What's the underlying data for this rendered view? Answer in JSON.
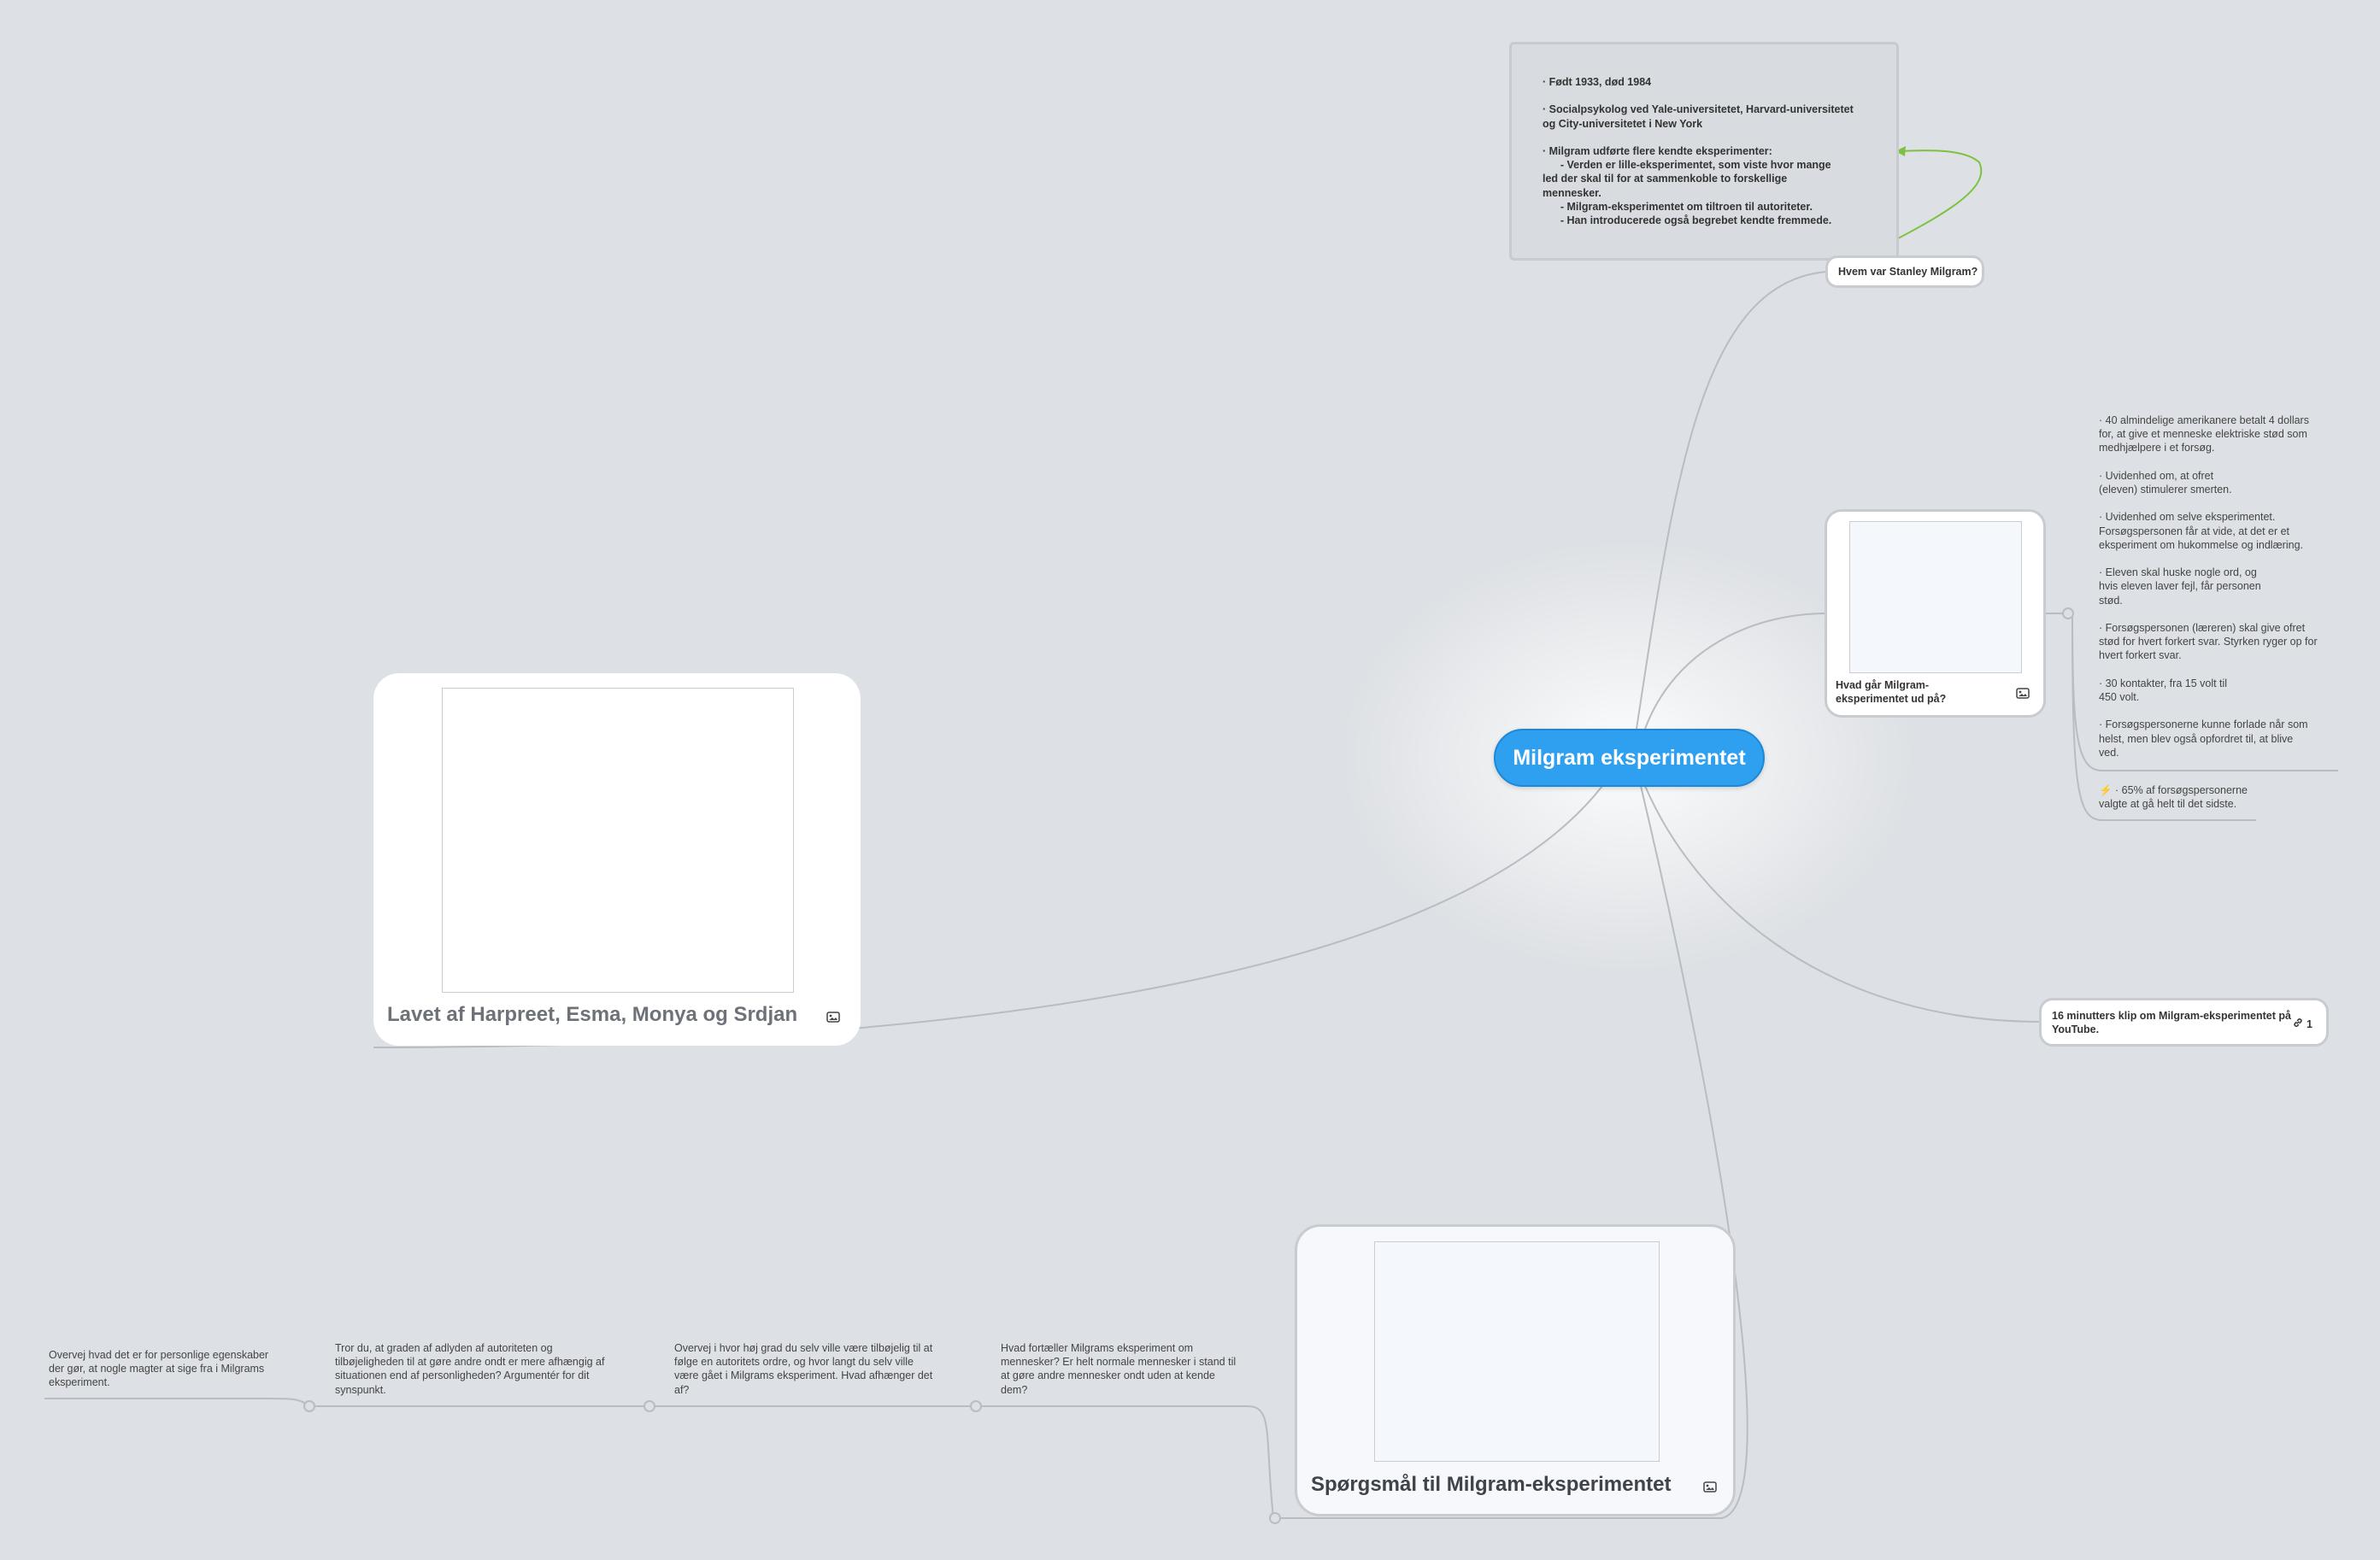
{
  "central": {
    "title": "Milgram eksperimentet"
  },
  "stanley": {
    "label": "Hvem var Stanley Milgram?",
    "note": [
      "· Født 1933, død 1984",
      "· Socialpsykolog ved Yale-universitetet, Harvard-universitetet\nog City-universitetet i New York",
      "· Milgram udførte flere kendte eksperimenter:\n      - Verden er lille-eksperimentet, som viste hvor mange\nled der skal til for at sammenkoble to forskellige\nmennesker.\n      - Milgram-eksperimentet om tiltroen til autoriteter.\n      - Han introducerede også begrebet kendte fremmede."
    ]
  },
  "hvad": {
    "label": "Hvad går Milgram-eksperimentet ud på?",
    "icon": "image-icon",
    "facts": [
      "· 40 almindelige amerikanere betalt 4 dollars\nfor, at give et menneske elektriske stød som\nmedhjælpere i et forsøg.",
      "· Uvidenhed om, at ofret\n(eleven) stimulerer smerten.",
      "· Uvidenhed om selve eksperimentet.\nForsøgspersonen får at vide, at det er et\neksperiment om hukommelse og indlæring.",
      "· Eleven skal huske nogle ord, og\nhvis eleven laver fejl, får personen\nstød.",
      "· Forsøgspersonen (læreren) skal give ofret\nstød for hvert forkert svar. Styrken ryger op for\nhvert forkert svar.",
      "· 30 kontakter, fra 15 volt til\n450 volt.",
      "· Forsøgspersonerne kunne forlade når som\nhelst, men blev også opfordret til, at blive\nved."
    ],
    "fact_last": "⚡ · 65% af forsøgspersonerne\nvalgte at gå helt til det sidste."
  },
  "klip": {
    "label": "16 minutters klip om Milgram-eksperimentet på YouTube.",
    "link_count": "1",
    "icon": "link-icon"
  },
  "lavet": {
    "label": "Lavet af Harpreet, Esma, Monya og Srdjan",
    "icon": "image-icon"
  },
  "sporgsmal": {
    "label": "Spørgsmål til Milgram-eksperimentet",
    "icon": "image-icon",
    "questions": [
      "Hvad fortæller Milgrams eksperiment om\nmennesker? Er helt normale mennesker i stand til\nat gøre andre mennesker ondt uden at kende\ndem?",
      "Overvej i hvor høj grad du selv ville være tilbøjelig til at\nfølge en autoritets ordre, og hvor langt du selv ville\nvære gået i Milgrams eksperiment. Hvad afhænger det\naf?",
      "Tror du, at graden af adlyden af autoriteten og\ntilbøjeligheden til at gøre andre ondt er mere afhængig af\nsituationen end af personligheden? Argumentér for dit\nsynspunkt.",
      "Overvej hvad det er for personlige egenskaber\nder gør, at nogle magter at sige fra i Milgrams\neksperiment."
    ]
  },
  "colors": {
    "central": "#2f9ff0",
    "relation_arrow": "#7cc240",
    "connector": "#b9bcc1"
  }
}
